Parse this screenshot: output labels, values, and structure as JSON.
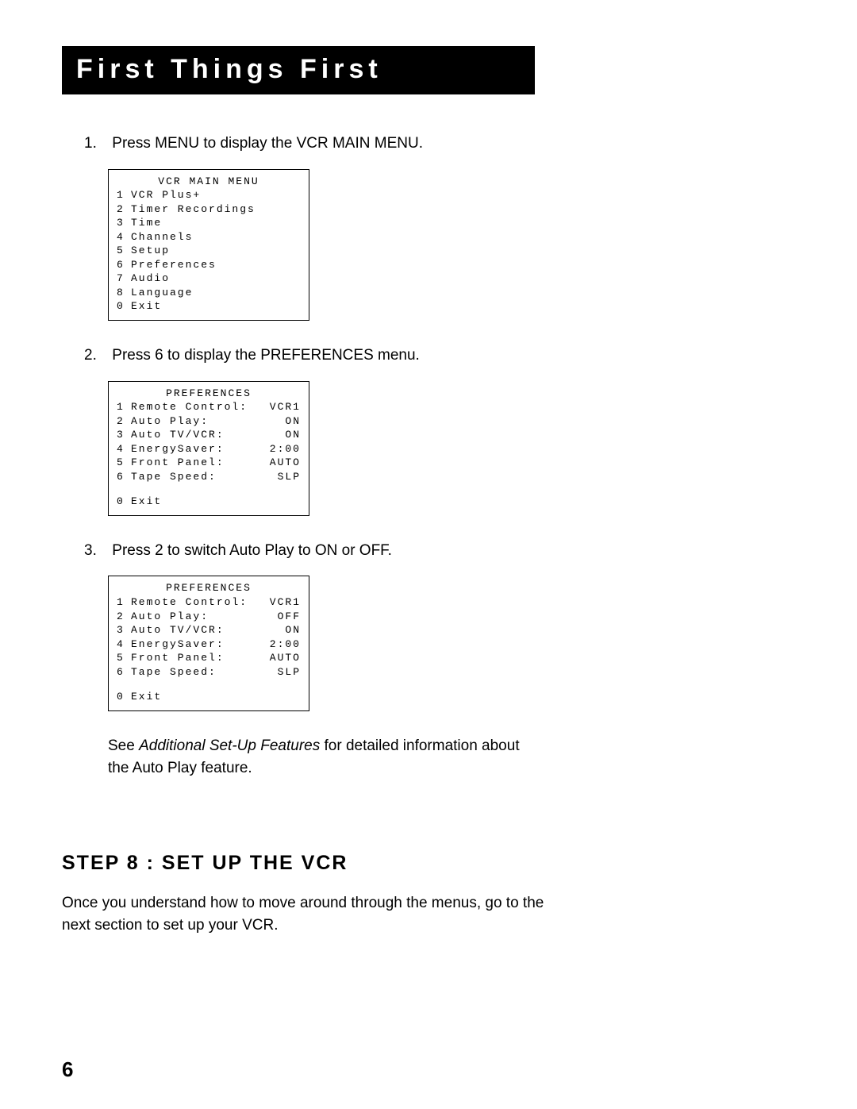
{
  "header": {
    "title": "First Things First"
  },
  "steps": [
    {
      "num": "1.",
      "text": "Press MENU to display the VCR MAIN MENU."
    },
    {
      "num": "2.",
      "text": "Press 6 to display the PREFERENCES menu."
    },
    {
      "num": "3.",
      "text": "Press 2 to switch Auto Play to ON or OFF."
    }
  ],
  "menu1": {
    "title": "VCR MAIN MENU",
    "items": [
      {
        "n": "1",
        "l": "VCR Plus+"
      },
      {
        "n": "2",
        "l": "Timer Recordings"
      },
      {
        "n": "3",
        "l": "Time"
      },
      {
        "n": "4",
        "l": "Channels"
      },
      {
        "n": "5",
        "l": "Setup"
      },
      {
        "n": "6",
        "l": "Preferences"
      },
      {
        "n": "7",
        "l": "Audio"
      },
      {
        "n": "8",
        "l": "Language"
      },
      {
        "n": "0",
        "l": "Exit"
      }
    ]
  },
  "menu2": {
    "title": "PREFERENCES",
    "items": [
      {
        "n": "1",
        "l": "Remote Control:",
        "v": "VCR1"
      },
      {
        "n": "2",
        "l": "Auto Play:",
        "v": "ON"
      },
      {
        "n": "3",
        "l": "Auto TV/VCR:",
        "v": "ON"
      },
      {
        "n": "4",
        "l": "EnergySaver:",
        "v": "2:00"
      },
      {
        "n": "5",
        "l": "Front Panel:",
        "v": "AUTO"
      },
      {
        "n": "6",
        "l": "Tape Speed:",
        "v": "SLP"
      }
    ],
    "exit": {
      "n": "0",
      "l": "Exit"
    }
  },
  "menu3": {
    "title": "PREFERENCES",
    "items": [
      {
        "n": "1",
        "l": "Remote Control:",
        "v": "VCR1"
      },
      {
        "n": "2",
        "l": "Auto Play:",
        "v": "OFF"
      },
      {
        "n": "3",
        "l": "Auto TV/VCR:",
        "v": "ON"
      },
      {
        "n": "4",
        "l": "EnergySaver:",
        "v": "2:00"
      },
      {
        "n": "5",
        "l": "Front Panel:",
        "v": "AUTO"
      },
      {
        "n": "6",
        "l": "Tape Speed:",
        "v": "SLP"
      }
    ],
    "exit": {
      "n": "0",
      "l": "Exit"
    }
  },
  "note": {
    "prefix": "See ",
    "italic": "Additional Set-Up Features",
    "suffix": " for detailed information about the Auto Play feature."
  },
  "section": {
    "heading": "STEP 8 : SET UP THE VCR",
    "body": "Once you understand how to move around through the menus, go to the next section to set up your VCR."
  },
  "page_number": "6"
}
